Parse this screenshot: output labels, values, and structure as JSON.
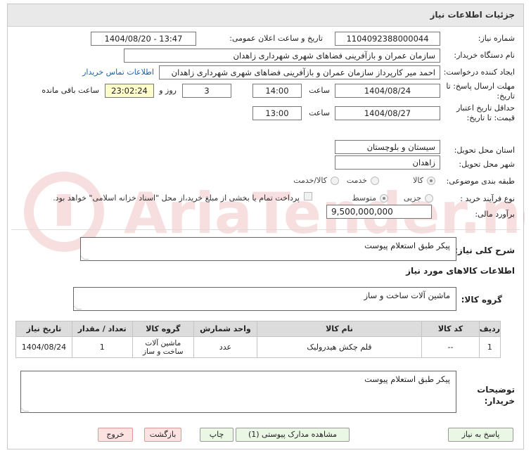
{
  "header": {
    "title": "جزئیات اطلاعات نیاز"
  },
  "fields": {
    "need_number_label": "شماره نیاز:",
    "need_number": "1104092388000044",
    "announce_label": "تاریخ و ساعت اعلان عمومی:",
    "announce_value": "1404/08/20 - 13:47",
    "buyer_org_label": "نام دستگاه خریدار:",
    "buyer_org": "سازمان عمران و بازآفرینی فضاهای شهری شهرداری زاهدان",
    "requester_label": "ایجاد کننده درخواست:",
    "requester": "احمد میر کارپرداز سازمان عمران و بازآفرینی فضاهای شهری شهرداری زاهدان",
    "contact_link": "اطلاعات تماس خریدار",
    "reply_deadline_label": "مهلت ارسال پاسخ: تا تاریخ:",
    "reply_date": "1404/08/24",
    "time_label": "ساعت",
    "reply_time": "14:00",
    "days_value": "3",
    "days_label": "روز و",
    "remaining_time": "23:02:24",
    "remaining_label": "ساعت باقی مانده",
    "validity_label": "حداقل تاریخ اعتبار قیمت: تا تاریخ:",
    "validity_date": "1404/08/27",
    "validity_time": "13:00",
    "province_label": "استان محل تحویل:",
    "province": "سیستان و بلوچستان",
    "city_label": "شهر محل تحویل:",
    "city": "زاهدان",
    "category_label": "طبقه بندی موضوعی:",
    "category_options": [
      "کالا",
      "خدمت",
      "کالا/خدمت"
    ],
    "purchase_type_label": "نوع فرآیند خرید :",
    "purchase_options": [
      "جزیی",
      "متوسط"
    ],
    "payment_note": "پرداخت تمام یا بخشی از مبلغ خرید،از محل \"اسناد خزانه اسلامی\" خواهد بود.",
    "budget_label": "برآورد مالی:",
    "budget": "9,500,000,000"
  },
  "description": {
    "label": "شرح کلی نیاز:",
    "value": "پیکر طبق استعلام پیوست"
  },
  "goods_info": {
    "title": "اطلاعات کالاهای مورد نیاز",
    "group_label": "گروه کالا:",
    "group_value": "ماشین آلات ساخت و ساز"
  },
  "table": {
    "headers": [
      "ردیف",
      "کد کالا",
      "نام کالا",
      "واحد شمارش",
      "گروه کالا",
      "تعداد / مقدار",
      "تاریخ نیاز"
    ],
    "rows": [
      [
        "1",
        "--",
        "قلم چکش هیدرولیک",
        "عدد",
        "ماشین آلات ساخت و ساز",
        "1",
        "1404/08/24"
      ]
    ]
  },
  "buyer_notes": {
    "label": "توضیحات خریدار:",
    "value": "پیکر طبق استعلام پیوست"
  },
  "buttons": {
    "reply": "پاسخ به نیاز",
    "attachments": "مشاهده مدارک پیوستی (1)",
    "print": "چاپ",
    "back": "بازگشت",
    "exit": "خروج"
  }
}
